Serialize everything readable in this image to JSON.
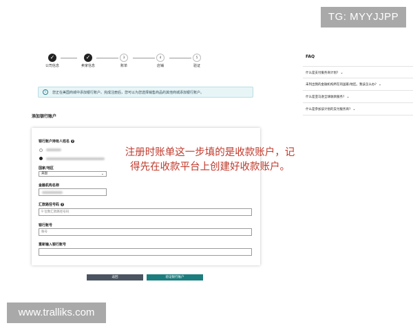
{
  "watermarks": {
    "tg": "TG: MYYJJPP",
    "site": "www.tralliks.com"
  },
  "stepper": {
    "steps": [
      {
        "num": "1",
        "label": "公司信息",
        "state": "done"
      },
      {
        "num": "2",
        "label": "卖家信息",
        "state": "done"
      },
      {
        "num": "3",
        "label": "账单",
        "state": "current"
      },
      {
        "num": "4",
        "label": "店铺",
        "state": "todo"
      },
      {
        "num": "5",
        "label": "验证",
        "state": "todo"
      }
    ]
  },
  "banner": {
    "icon": "info-icon",
    "text": "您正在美国商城中添加银行账户。完成注册后，您可以为您选择销售商品的其他商城添加银行账户。"
  },
  "form": {
    "section_title": "添加银行账户",
    "account_holder_label": "银行账户持有人姓名",
    "country_label": "国家/地区",
    "country_value": "美国",
    "institution_label": "金融机构名称",
    "routing_label": "汇款路径号码",
    "routing_placeholder": "9 位数汇款路径号码",
    "account_label": "银行账号",
    "account_placeholder": "账号",
    "account_confirm_label": "重新输入银行账号"
  },
  "buttons": {
    "back": "返回",
    "verify": "验证银行账户"
  },
  "faq": {
    "title": "FAQ",
    "items": [
      "什么是支付服务商计划?",
      "未列出我的金融机构所在的国家/地区。我该怎么办?",
      "什么是亚马逊全球收款服务?",
      "什么是参加该计划的支付服务商?"
    ]
  },
  "annotation": "注册时账单这一步填的是收款账户，记得先在收款平台上创建好收款账户。",
  "colors": {
    "annotation": "#c0392b",
    "verify_button": "#1c7d7f",
    "back_button": "#4a5561",
    "banner_bg": "#e8f5f7"
  }
}
